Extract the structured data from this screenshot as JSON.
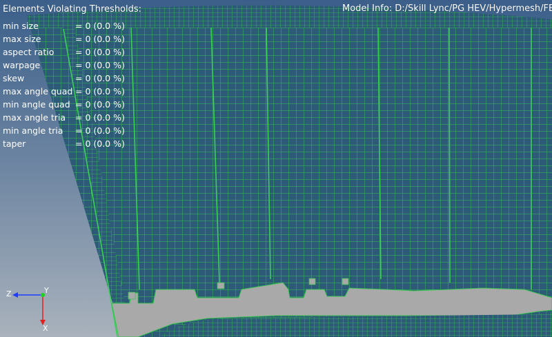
{
  "overlay": {
    "thresholds_title": "Elements Violating Thresholds:",
    "model_info": "Model Info: D:/Skill Lync/PG HEV/Hypermesh/FEA/"
  },
  "checks": [
    {
      "name": "min size",
      "value": "= 0 (0.0 %)"
    },
    {
      "name": "max size",
      "value": "= 0 (0.0 %)"
    },
    {
      "name": "aspect ratio",
      "value": "= 0 (0.0 %)"
    },
    {
      "name": "warpage",
      "value": "= 0 (0.0 %)"
    },
    {
      "name": "skew",
      "value": "= 0 (0.0 %)"
    },
    {
      "name": "max angle quad",
      "value": "= 0 (0.0 %)"
    },
    {
      "name": "min angle quad",
      "value": "= 0 (0.0 %)"
    },
    {
      "name": "max angle tria",
      "value": "= 0 (0.0 %)"
    },
    {
      "name": "min angle tria",
      "value": "= 0 (0.0 %)"
    },
    {
      "name": "taper",
      "value": "= 0 (0.0 %)"
    }
  ],
  "triad": {
    "z_label": "Z",
    "y_label": "Y",
    "x_label": "X"
  },
  "colors": {
    "background_top": "#3b5f8a",
    "background_bottom": "#aab3bd",
    "mesh_fill": "#2e5d78",
    "mesh_line": "#35c24e",
    "cutout": "#a8a8a8",
    "triad_z": "#1e3cff",
    "triad_x": "#e02020",
    "triad_y": "#20d020"
  }
}
